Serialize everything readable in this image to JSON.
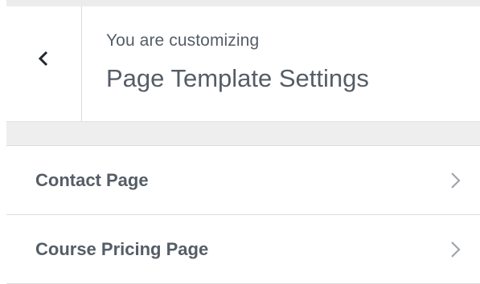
{
  "header": {
    "back_icon": "chevron-left-icon",
    "subtitle": "You are customizing",
    "title": "Page Template Settings"
  },
  "sections": [
    {
      "label": "Contact Page",
      "icon": "chevron-right-icon"
    },
    {
      "label": "Course Pricing Page",
      "icon": "chevron-right-icon"
    }
  ],
  "colors": {
    "text": "#555d66",
    "band": "#eeeeee",
    "divider": "#dddddd"
  }
}
